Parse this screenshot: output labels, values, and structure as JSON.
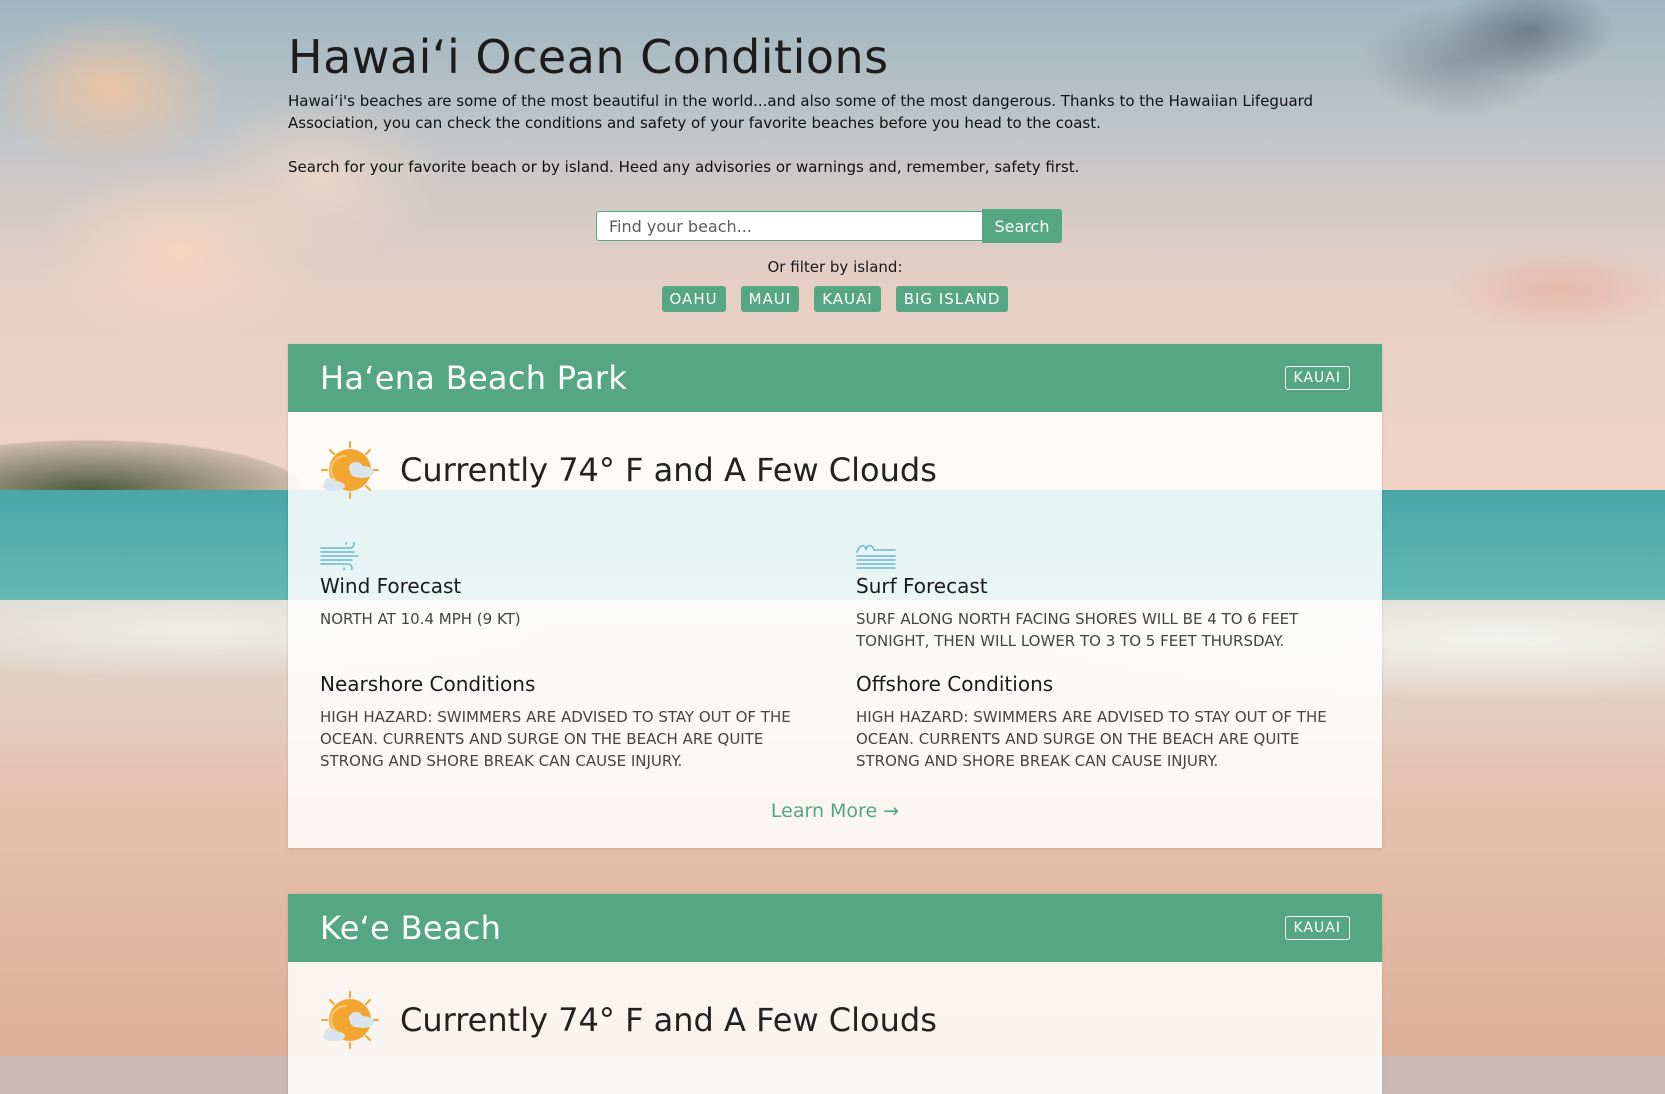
{
  "page": {
    "title": "Hawaiʻi Ocean Conditions",
    "intro_1": "Hawaiʻi's beaches are some of the most beautiful in the world...and also some of the most dangerous. Thanks to the Hawaiian Lifeguard Association, you can check the conditions and safety of your favorite beaches before you head to the coast.",
    "intro_2": "Search for your favorite beach or by island. Heed any advisories or warnings and, remember, safety first."
  },
  "search": {
    "placeholder": "Find your beach...",
    "value": "",
    "button_label": "Search"
  },
  "filter": {
    "label": "Or filter by island:",
    "islands": [
      "OAHU",
      "MAUI",
      "KAUAI",
      "BIG ISLAND"
    ]
  },
  "colors": {
    "accent": "#55a683",
    "card_background": "#ffffff",
    "sun": "#f2a531",
    "cloud": "#d8e5ec",
    "wind_icon": "#6fb8d8"
  },
  "beaches": [
    {
      "name": "Haʻena Beach Park",
      "island": "KAUAI",
      "weather_icon": "sun-cloud-icon",
      "weather": "Currently 74° F and A Few Clouds",
      "wind": {
        "icon": "wind-icon",
        "title": "Wind Forecast",
        "text": "North at 10.4 MPH (9 KT)"
      },
      "surf": {
        "icon": "waves-icon",
        "title": "Surf Forecast",
        "text": "Surf along north facing shores will be 4 to 6 feet tonight, then will lower to 3 to 5 feet Thursday."
      },
      "nearshore": {
        "title": "Nearshore Conditions",
        "text": "High Hazard: Swimmers are advised to stay out of the ocean. Currents and surge on the beach are quite strong and shore break can cause injury."
      },
      "offshore": {
        "title": "Offshore Conditions",
        "text": "High Hazard: Swimmers are advised to stay out of the ocean. Currents and surge on the beach are quite strong and shore break can cause injury."
      },
      "learn_more": "Learn More →"
    },
    {
      "name": "Keʻe Beach",
      "island": "KAUAI",
      "weather_icon": "sun-cloud-icon",
      "weather": "Currently 74° F and A Few Clouds"
    }
  ]
}
